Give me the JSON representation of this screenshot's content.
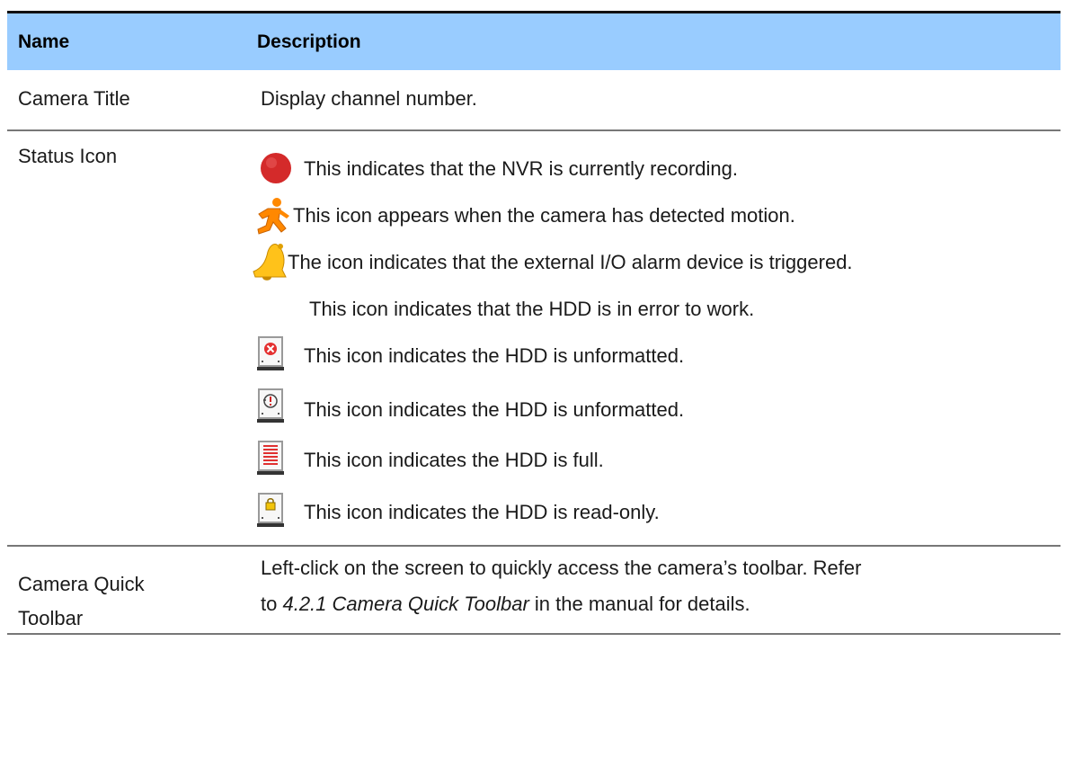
{
  "header": {
    "col_name": "Name",
    "col_description": "Description"
  },
  "rows": [
    {
      "name": "Camera Title",
      "description": "Display channel number."
    },
    {
      "name": "Status Icon",
      "items": [
        {
          "icon": "recording-dot-icon",
          "text": "This indicates that the NVR is currently recording."
        },
        {
          "icon": "running-man-motion-icon",
          "text": "This icon appears when the camera has detected motion."
        },
        {
          "icon": "alarm-bell-icon",
          "text": "The icon indicates that the external I/O alarm device is triggered."
        },
        {
          "icon": "",
          "text": "This icon indicates that the HDD is in error to work."
        },
        {
          "icon": "hdd-error-x-icon",
          "text": "This icon indicates the HDD is unformatted."
        },
        {
          "icon": "hdd-unformatted-icon",
          "text": "This icon indicates the HDD is unformatted."
        },
        {
          "icon": "hdd-full-icon",
          "text": "This icon indicates the HDD is full."
        },
        {
          "icon": "hdd-read-only-lock-icon",
          "text": "This icon indicates the HDD is read-only."
        }
      ]
    },
    {
      "name_line1": "Camera Quick",
      "name_line2": "Toolbar",
      "desc_line1": "Left-click on the screen to quickly access the camera’s toolbar. Refer",
      "desc_line2_prefix": "to ",
      "desc_line2_ref": "4.2.1 Camera Quick Toolbar",
      "desc_line2_suffix": " in the manual for details."
    }
  ],
  "colors": {
    "header_bg": "#99ccff",
    "record_red": "#d42a2a",
    "motion_orange": "#ff8800",
    "bell_yellow": "#ffc21a"
  }
}
